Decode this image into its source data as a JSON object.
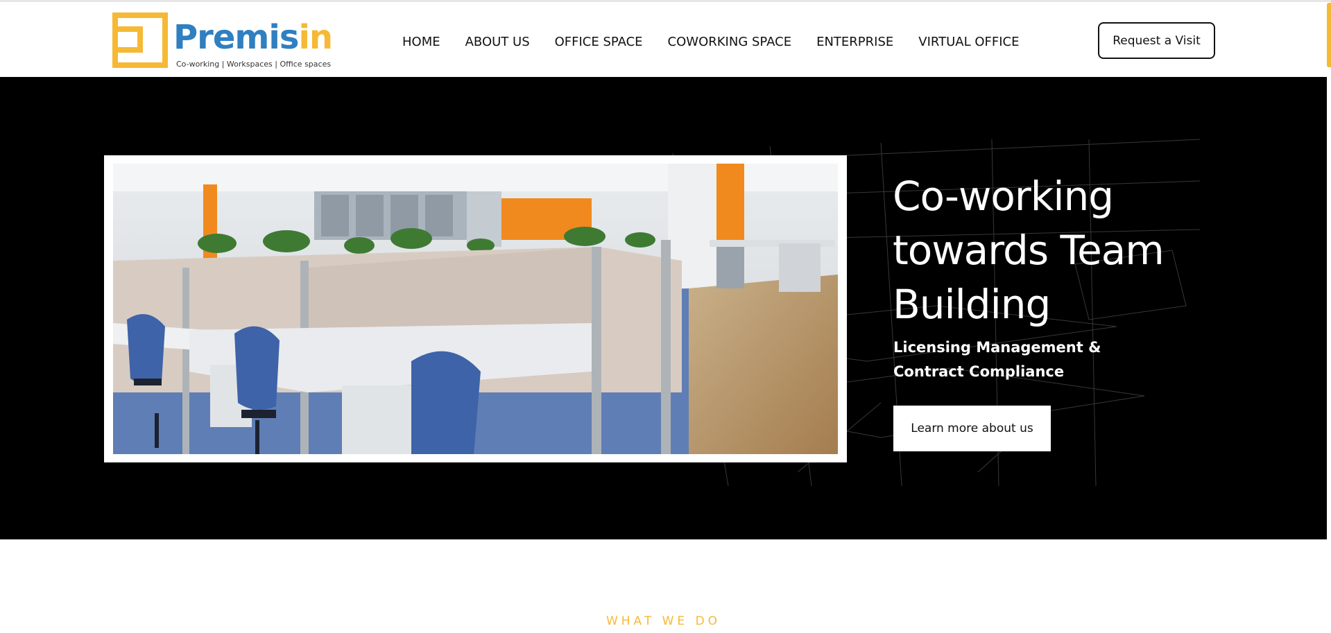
{
  "brand": {
    "name_main": "Premis",
    "name_accent": "in",
    "tagline": "Co-working | Workspaces | Office spaces",
    "colors": {
      "primary": "#2f7fc1",
      "accent": "#f6b935"
    }
  },
  "nav": {
    "items": [
      {
        "label": "HOME"
      },
      {
        "label": "ABOUT US"
      },
      {
        "label": "OFFICE SPACE"
      },
      {
        "label": "COWORKING SPACE"
      },
      {
        "label": "ENTERPRISE"
      },
      {
        "label": "VIRTUAL OFFICE"
      }
    ]
  },
  "header": {
    "cta_label": "Request a Visit"
  },
  "hero": {
    "title": "Co-working towards Team Building",
    "subtitle": "Licensing Management & Contract Compliance",
    "cta_label": "Learn more about us",
    "background": "#000000"
  },
  "section": {
    "label": "WHAT WE DO"
  }
}
